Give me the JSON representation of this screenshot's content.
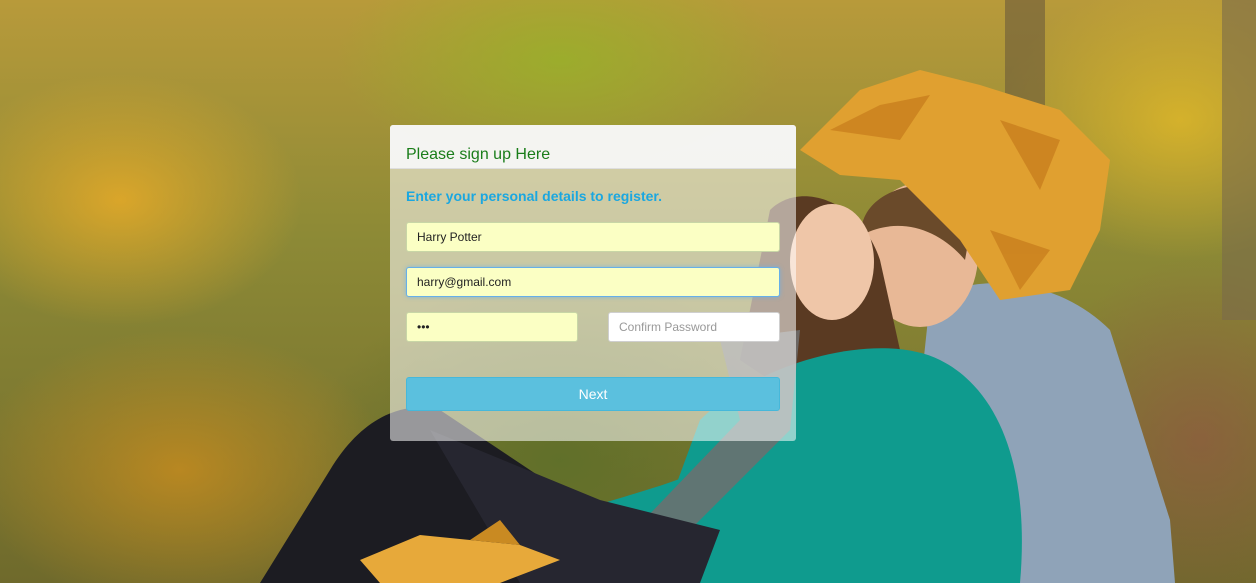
{
  "form": {
    "title": "Please sign up Here",
    "subtitle": "Enter your personal details to register.",
    "name_value": "Harry Potter",
    "email_value": "harry@gmail.com",
    "password_value": "•••",
    "confirm_placeholder": "Confirm Password",
    "next_label": "Next"
  },
  "colors": {
    "title": "#1a7d1a",
    "subtitle": "#1ba7e0",
    "button": "#5bc0de",
    "autofill": "#fbffc4"
  }
}
